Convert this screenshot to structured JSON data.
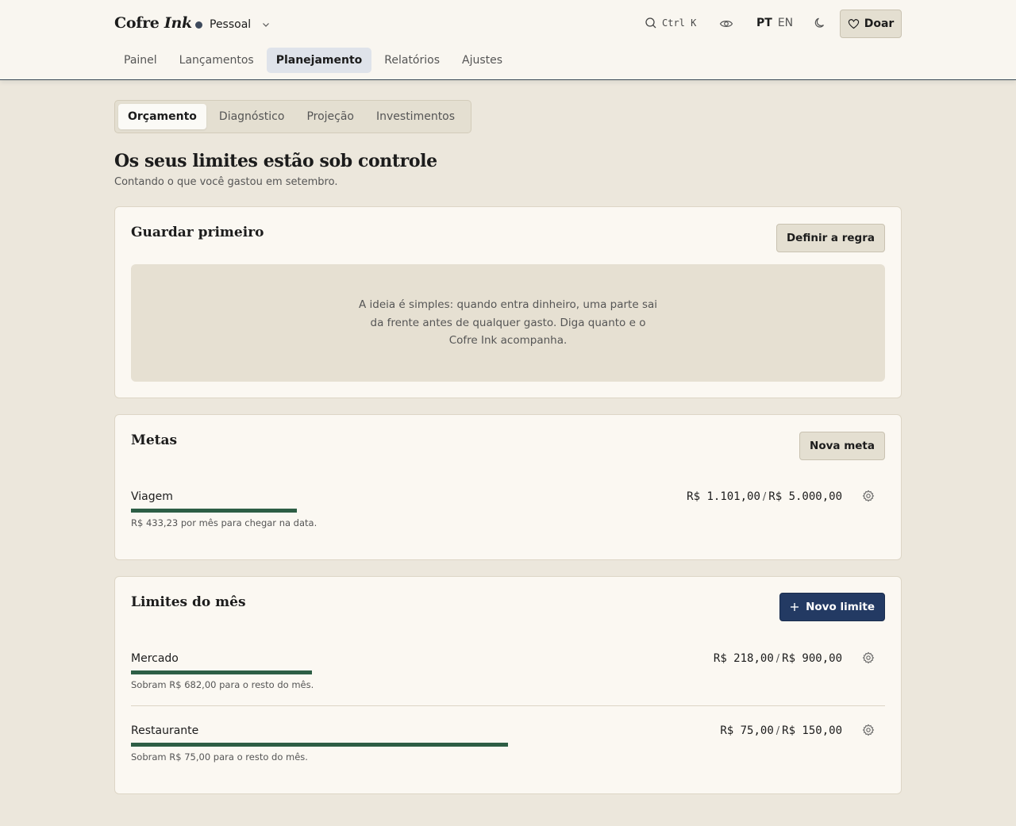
{
  "header": {
    "brand_main": "Cofre",
    "brand_accent": "Ink",
    "profile": "Pessoal",
    "search_shortcut": "Ctrl K",
    "lang_active": "PT",
    "lang_other": "EN",
    "donate_label": "Doar"
  },
  "nav": {
    "items": [
      "Painel",
      "Lançamentos",
      "Planejamento",
      "Relatórios",
      "Ajustes"
    ],
    "active": "Planejamento"
  },
  "subtabs": {
    "items": [
      "Orçamento",
      "Diagnóstico",
      "Projeção",
      "Investimentos"
    ],
    "active": "Orçamento"
  },
  "page": {
    "title": "Os seus limites estão sob controle",
    "subtitle": "Contando o que você gastou em setembro."
  },
  "savings": {
    "title": "Guardar primeiro",
    "button": "Definir a regra",
    "empty_text": "A ideia é simples: quando entra dinheiro, uma parte sai da frente antes de qualquer gasto. Diga quanto e o Cofre Ink acompanha."
  },
  "goals": {
    "title": "Metas",
    "button": "Nova meta",
    "items": [
      {
        "name": "Viagem",
        "current": "R$ 1.101,00",
        "target": "R$ 5.000,00",
        "progress": 0.22,
        "hint": "R$ 433,23 por mês para chegar na data."
      }
    ]
  },
  "limits": {
    "title": "Limites do mês",
    "button": "Novo limite",
    "items": [
      {
        "name": "Mercado",
        "spent": "R$ 218,00",
        "limit": "R$ 900,00",
        "progress": 0.24,
        "hint": "Sobram R$ 682,00 para o resto do mês."
      },
      {
        "name": "Restaurante",
        "spent": "R$ 75,00",
        "limit": "R$ 150,00",
        "progress": 0.5,
        "hint": "Sobram R$ 75,00 para o resto do mês."
      }
    ]
  },
  "colors": {
    "accent": "#233a63",
    "progress": "#2d5e45",
    "background": "#ece7dc",
    "card": "#fbf8f2"
  }
}
